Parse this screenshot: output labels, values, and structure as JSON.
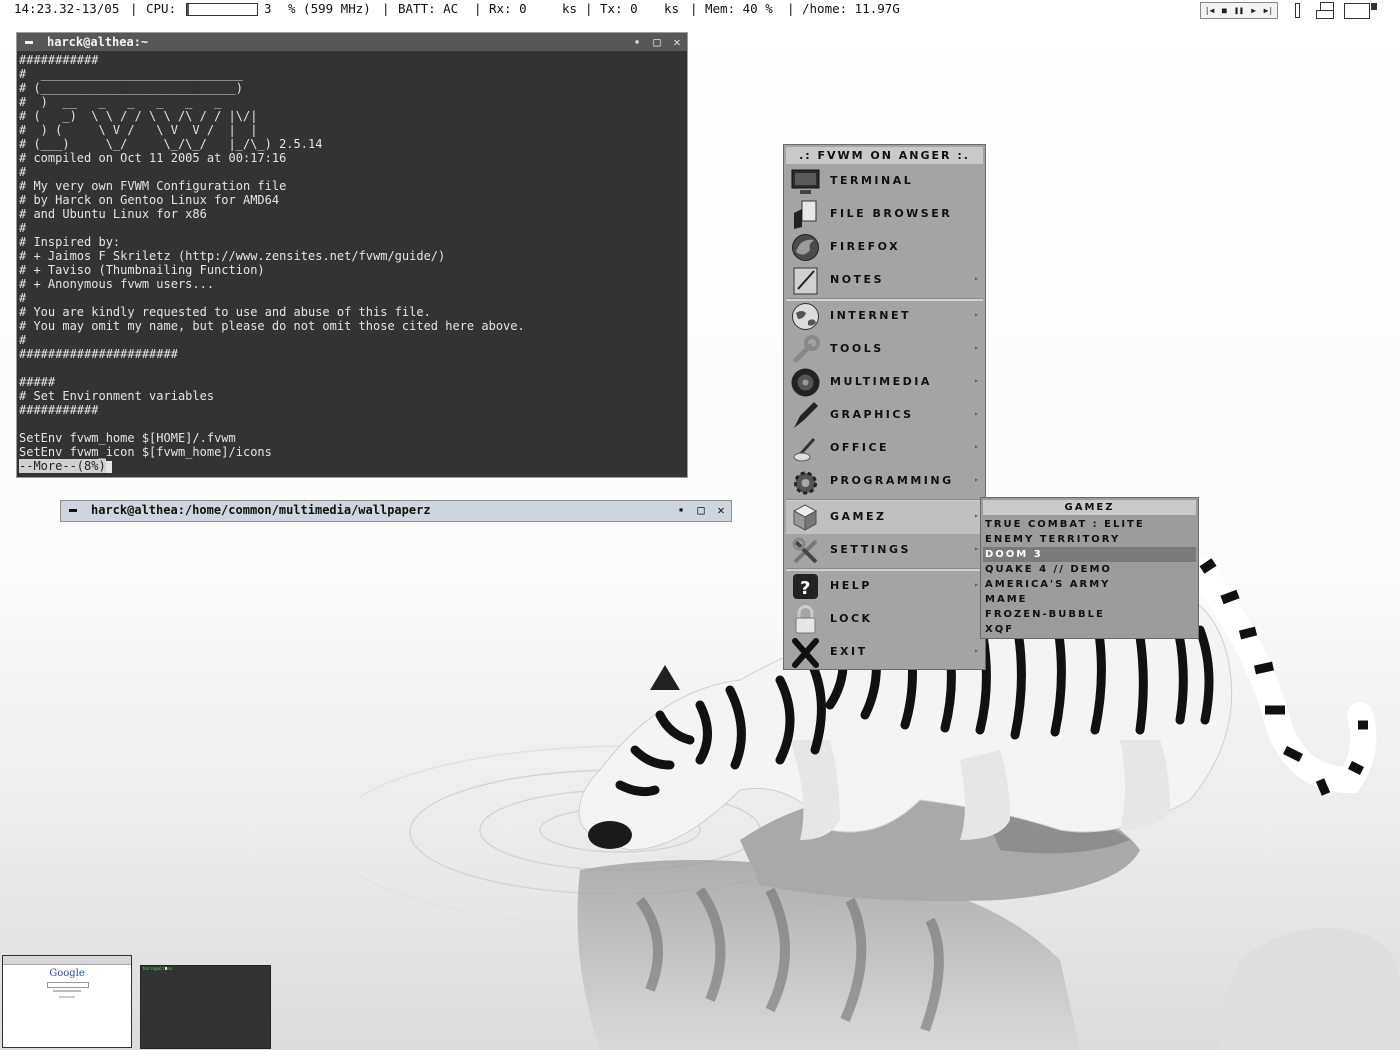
{
  "statusbar": {
    "datetime": "14:23.32-13/05",
    "sep1": "|",
    "cpu_label": "CPU:",
    "cpu_value": "3",
    "cpu_unit": "% (599 MHz)",
    "sep2": "|",
    "batt": "BATT: AC",
    "sep3": "|",
    "rx_label": "Rx: 0",
    "rx_unit": "ks",
    "sep4": "|",
    "tx_label": "Tx: 0",
    "tx_unit": "ks",
    "sep5": "|",
    "mem": "Mem: 40 %",
    "sep6": "|",
    "home": "/home: 11.97G",
    "cpu_fraction": 0.03,
    "media_icons": [
      "skip-back-icon",
      "stop-icon",
      "pause-icon",
      "play-icon",
      "skip-forward-icon"
    ],
    "media_glyphs": [
      "|◀",
      "■",
      "❚❚",
      "▶",
      "▶|"
    ]
  },
  "terminal1": {
    "title": "harck@althea:~",
    "lines": [
      "###########",
      "#  ____________________________",
      "# (___________________________)",
      "#  )  __   _   _   _   _   _",
      "# (   _)  \\ \\ / / \\ \\ /\\ / / |\\/|",
      "#  ) (     \\ V /   \\ V  V /  |  |",
      "# (___)     \\_/     \\_/\\_/   |_/\\_) 2.5.14",
      "# compiled on Oct 11 2005 at 00:17:16",
      "#",
      "# My very own FVWM Configuration file",
      "# by Harck on Gentoo Linux for AMD64",
      "# and Ubuntu Linux for x86",
      "#",
      "# Inspired by:",
      "# + Jaimos F Skriletz (http://www.zensites.net/fvwm/guide/)",
      "# + Taviso (Thumbnailing Function)",
      "# + Anonymous fvwm users...",
      "#",
      "# You are kindly requested to use and abuse of this file.",
      "# You may omit my name, but please do not omit those cited here above.",
      "#",
      "######################",
      "",
      "#####",
      "# Set Environment variables",
      "###########",
      "",
      "SetEnv fvwm_home $[HOME]/.fvwm",
      "SetEnv fvwm_icon $[fvwm_home]/icons"
    ],
    "more_prompt": "--More--(8%)"
  },
  "terminal2": {
    "title": "harck@althea:/home/common/multimedia/wallpaperz"
  },
  "window_buttons": {
    "minimize_glyph": "▪",
    "maximize_glyph": "□",
    "close_glyph": "✕"
  },
  "menu": {
    "title": ".: FVWM ON ANGER :.",
    "items": [
      {
        "label": "Terminal",
        "icon": "terminal-icon",
        "submenu": false
      },
      {
        "label": "File Browser",
        "icon": "file-browser-icon",
        "submenu": false
      },
      {
        "label": "Firefox",
        "icon": "firefox-icon",
        "submenu": false
      },
      {
        "label": "Notes",
        "icon": "notes-icon",
        "submenu": true
      },
      {
        "label": "Internet",
        "icon": "globe-icon",
        "submenu": true
      },
      {
        "label": "Tools",
        "icon": "wrench-icon",
        "submenu": true
      },
      {
        "label": "Multimedia",
        "icon": "multimedia-icon",
        "submenu": true
      },
      {
        "label": "Graphics",
        "icon": "pen-icon",
        "submenu": true
      },
      {
        "label": "Office",
        "icon": "office-icon",
        "submenu": true
      },
      {
        "label": "Programming",
        "icon": "gear-icon",
        "submenu": true
      },
      {
        "label": "Gamez",
        "icon": "cubes-icon",
        "submenu": true,
        "active": true
      },
      {
        "label": "Settings",
        "icon": "settings-icon",
        "submenu": true
      },
      {
        "label": "Help",
        "icon": "help-icon",
        "submenu": true
      },
      {
        "label": "Lock",
        "icon": "lock-icon",
        "submenu": false
      },
      {
        "label": "Exit",
        "icon": "exit-icon",
        "submenu": true
      }
    ],
    "arrow_glyph": "▸"
  },
  "submenu": {
    "title": "GAMEZ",
    "items": [
      "True Combat : Elite",
      "Enemy Territory",
      "Doom 3",
      "Quake 4 // Demo",
      "America's Army",
      "Mame",
      "Frozen-Bubble",
      "XQF"
    ],
    "highlighted_index": 2
  },
  "thumbnails": {
    "browser_logo": "Google",
    "terminal_prompt": "harck@althea"
  },
  "colors": {
    "terminal_bg": "#333333",
    "terminal_title_bg": "#575757",
    "inactive_title_bg": "#cfd5dc",
    "menu_bg": "#a4a4a4",
    "submenu_highlight": "#7a7a7a"
  }
}
